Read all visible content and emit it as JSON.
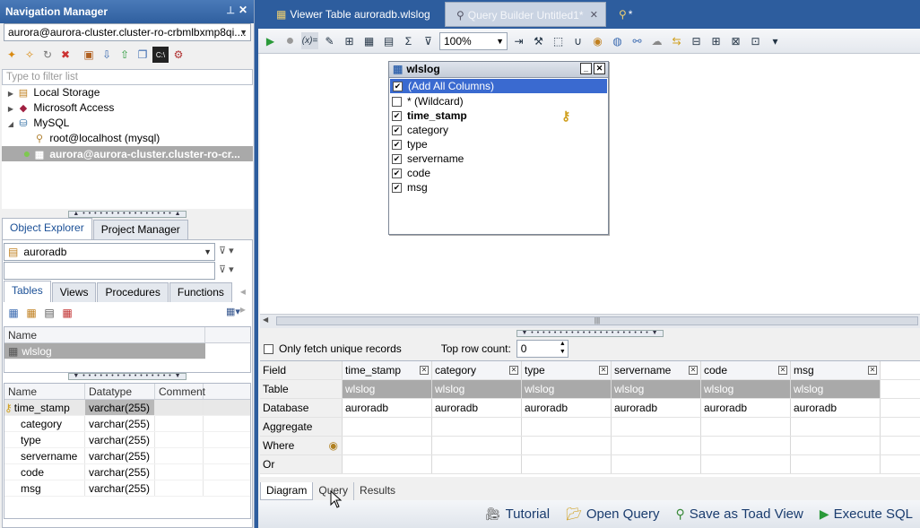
{
  "nav_manager": {
    "title": "Navigation Manager",
    "connection": "aurora@aurora-cluster.cluster-ro-crbmlbxmp8qi....",
    "filter_placeholder": "Type to filter list",
    "tree": [
      {
        "label": "Local Storage",
        "icon": "storage-icon"
      },
      {
        "label": "Microsoft Access",
        "icon": "access-icon"
      },
      {
        "label": "MySQL",
        "icon": "mysql-icon"
      },
      {
        "label": "root@localhost (mysql)",
        "icon": "connection-icon"
      },
      {
        "label": "aurora@aurora-cluster.cluster-ro-cr...",
        "icon": "connection-icon"
      }
    ]
  },
  "object_explorer": {
    "tabs": [
      "Object Explorer",
      "Project Manager"
    ],
    "database": "auroradb",
    "object_tabs": [
      "Tables",
      "Views",
      "Procedures",
      "Functions"
    ],
    "list_header": "Name",
    "list_items": [
      "wlslog"
    ],
    "columns_header": [
      "Name",
      "Datatype",
      "Comment"
    ],
    "columns": [
      {
        "name": "time_stamp",
        "type": "varchar(255)",
        "key": true
      },
      {
        "name": "category",
        "type": "varchar(255)"
      },
      {
        "name": "type",
        "type": "varchar(255)"
      },
      {
        "name": "servername",
        "type": "varchar(255)"
      },
      {
        "name": "code",
        "type": "varchar(255)"
      },
      {
        "name": "msg",
        "type": "varchar(255)"
      }
    ]
  },
  "doc_tabs": [
    "Viewer Table auroradb.wlslog",
    "Query Builder Untitled1*",
    "*"
  ],
  "toolbar": {
    "zoom": "100%"
  },
  "table_box": {
    "title": "wlslog",
    "columns": [
      {
        "label": "(Add All Columns)",
        "checked": true,
        "selected": true
      },
      {
        "label": "* (Wildcard)",
        "checked": false
      },
      {
        "label": "time_stamp",
        "checked": true,
        "bold": true
      },
      {
        "label": "category",
        "checked": true
      },
      {
        "label": "type",
        "checked": true
      },
      {
        "label": "servername",
        "checked": true
      },
      {
        "label": "code",
        "checked": true
      },
      {
        "label": "msg",
        "checked": true
      }
    ]
  },
  "options": {
    "unique_label": "Only fetch unique records",
    "toprow_label": "Top row count:",
    "toprow_value": "0"
  },
  "query_grid": {
    "row_labels": [
      "Field",
      "Table",
      "Database",
      "Aggregate",
      "Where",
      "Or"
    ],
    "fields": [
      "time_stamp",
      "category",
      "type",
      "servername",
      "code",
      "msg"
    ],
    "table": "wlslog",
    "database": "auroradb"
  },
  "bottom_tabs": [
    "Diagram",
    "Query",
    "Results"
  ],
  "actions": [
    "Tutorial",
    "Open Query",
    "Save as Toad View",
    "Execute SQL"
  ]
}
